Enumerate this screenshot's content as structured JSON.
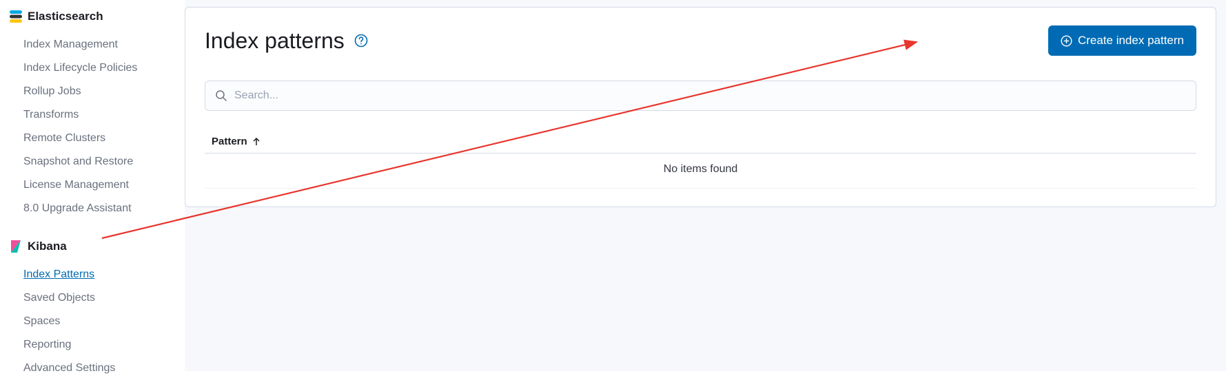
{
  "sidebar": {
    "sections": [
      {
        "title": "Elasticsearch",
        "items": [
          {
            "label": "Index Management",
            "active": false
          },
          {
            "label": "Index Lifecycle Policies",
            "active": false
          },
          {
            "label": "Rollup Jobs",
            "active": false
          },
          {
            "label": "Transforms",
            "active": false
          },
          {
            "label": "Remote Clusters",
            "active": false
          },
          {
            "label": "Snapshot and Restore",
            "active": false
          },
          {
            "label": "License Management",
            "active": false
          },
          {
            "label": "8.0 Upgrade Assistant",
            "active": false
          }
        ]
      },
      {
        "title": "Kibana",
        "items": [
          {
            "label": "Index Patterns",
            "active": true
          },
          {
            "label": "Saved Objects",
            "active": false
          },
          {
            "label": "Spaces",
            "active": false
          },
          {
            "label": "Reporting",
            "active": false
          },
          {
            "label": "Advanced Settings",
            "active": false
          }
        ]
      }
    ]
  },
  "main": {
    "title": "Index patterns",
    "create_button_label": "Create index pattern",
    "search": {
      "placeholder": "Search..."
    },
    "table": {
      "column_header": "Pattern",
      "empty_message": "No items found"
    }
  }
}
